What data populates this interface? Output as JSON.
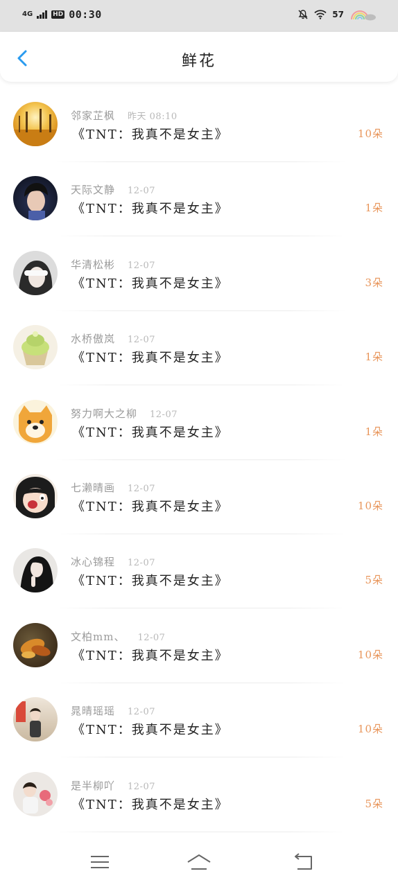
{
  "status_bar": {
    "network": "4G",
    "hd": "HD",
    "time": "00:30",
    "battery": "57"
  },
  "header": {
    "title": "鲜花",
    "back_icon": "chevron-left-icon",
    "accent_color": "#2a9bef"
  },
  "rows": [
    {
      "username": "邻家芷枫",
      "date": "昨天 08:10",
      "book": "《TNT：我真不是女主》",
      "quantity": "10朵",
      "avatar": "autumn-trees-avatar"
    },
    {
      "username": "天际文静",
      "date": "12-07",
      "book": "《TNT：我真不是女主》",
      "quantity": "1朵",
      "avatar": "young-man-portrait-avatar"
    },
    {
      "username": "华清松彬",
      "date": "12-07",
      "book": "《TNT：我真不是女主》",
      "quantity": "3朵",
      "avatar": "girl-covering-eyes-avatar"
    },
    {
      "username": "水桥傲岚",
      "date": "12-07",
      "book": "《TNT：我真不是女主》",
      "quantity": "1朵",
      "avatar": "cupcake-avatar"
    },
    {
      "username": "努力啊大之柳",
      "date": "12-07",
      "book": "《TNT：我真不是女主》",
      "quantity": "1朵",
      "avatar": "shiba-doge-avatar"
    },
    {
      "username": "七濑晴画",
      "date": "12-07",
      "book": "《TNT：我真不是女主》",
      "quantity": "10朵",
      "avatar": "cartoon-girl-avatar"
    },
    {
      "username": "冰心锦程",
      "date": "12-07",
      "book": "《TNT：我真不是女主》",
      "quantity": "5朵",
      "avatar": "dark-hair-girl-avatar"
    },
    {
      "username": "文柏mm、",
      "date": "12-07",
      "book": "《TNT：我真不是女主》",
      "quantity": "10朵",
      "avatar": "autumn-leaves-avatar"
    },
    {
      "username": "晁晴瑶瑶",
      "date": "12-07",
      "book": "《TNT：我真不是女主》",
      "quantity": "10朵",
      "avatar": "girl-in-room-avatar"
    },
    {
      "username": "是半柳吖",
      "date": "12-07",
      "book": "《TNT：我真不是女主》",
      "quantity": "5朵",
      "avatar": "child-with-toy-avatar"
    }
  ],
  "colors": {
    "quantity": "#e8955a",
    "username": "#9a9a9a",
    "status_bar_bg": "#e2e2e2"
  },
  "nav_bar": {
    "menu_icon": "menu-icon",
    "home_icon": "home-icon",
    "back_icon": "return-icon"
  }
}
